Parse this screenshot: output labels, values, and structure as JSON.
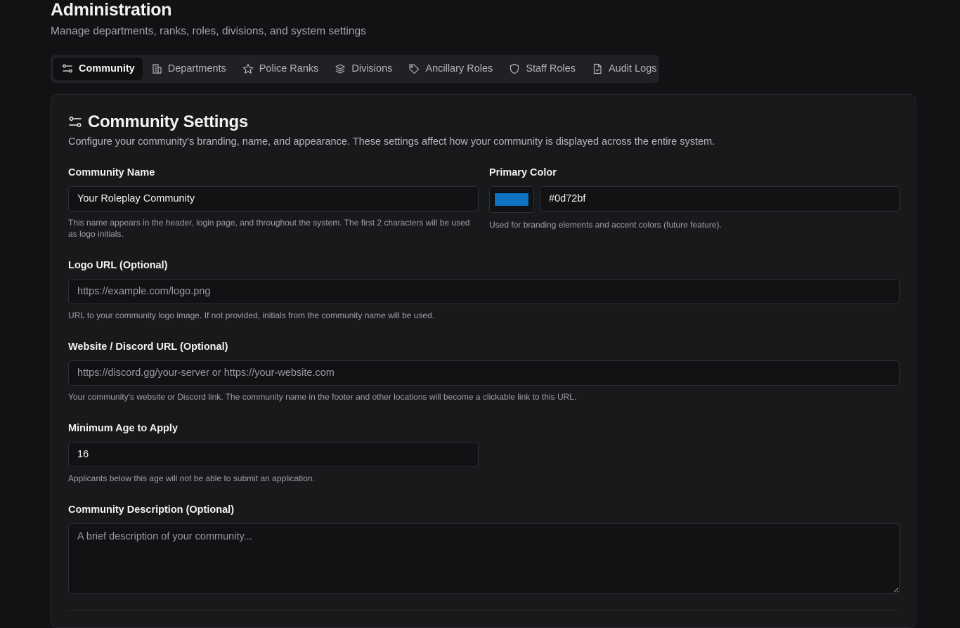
{
  "header": {
    "title": "Administration",
    "subtitle": "Manage departments, ranks, roles, divisions, and system settings"
  },
  "tabs": [
    {
      "label": "Community",
      "icon": "sliders-icon",
      "active": true
    },
    {
      "label": "Departments",
      "icon": "building-icon",
      "active": false
    },
    {
      "label": "Police Ranks",
      "icon": "star-icon",
      "active": false
    },
    {
      "label": "Divisions",
      "icon": "layers-icon",
      "active": false
    },
    {
      "label": "Ancillary Roles",
      "icon": "tag-icon",
      "active": false
    },
    {
      "label": "Staff Roles",
      "icon": "shield-icon",
      "active": false
    },
    {
      "label": "Audit Logs",
      "icon": "file-check-icon",
      "active": false
    }
  ],
  "settings": {
    "title": "Community Settings",
    "description": "Configure your community's branding, name, and appearance. These settings affect how your community is displayed across the entire system.",
    "community_name": {
      "label": "Community Name",
      "value": "Your Roleplay Community",
      "help": "This name appears in the header, login page, and throughout the system. The first 2 characters will be used as logo initials."
    },
    "primary_color": {
      "label": "Primary Color",
      "value": "#0d72bf",
      "color": "#0d72bf",
      "help": "Used for branding elements and accent colors (future feature)."
    },
    "logo_url": {
      "label": "Logo URL (Optional)",
      "value": "",
      "placeholder": "https://example.com/logo.png",
      "help": "URL to your community logo image. If not provided, initials from the community name will be used."
    },
    "website_url": {
      "label": "Website / Discord URL (Optional)",
      "value": "",
      "placeholder": "https://discord.gg/your-server or https://your-website.com",
      "help": "Your community's website or Discord link. The community name in the footer and other locations will become a clickable link to this URL."
    },
    "min_age": {
      "label": "Minimum Age to Apply",
      "value": "16",
      "help": "Applicants below this age will not be able to submit an application."
    },
    "description_field": {
      "label": "Community Description (Optional)",
      "value": "",
      "placeholder": "A brief description of your community..."
    }
  }
}
